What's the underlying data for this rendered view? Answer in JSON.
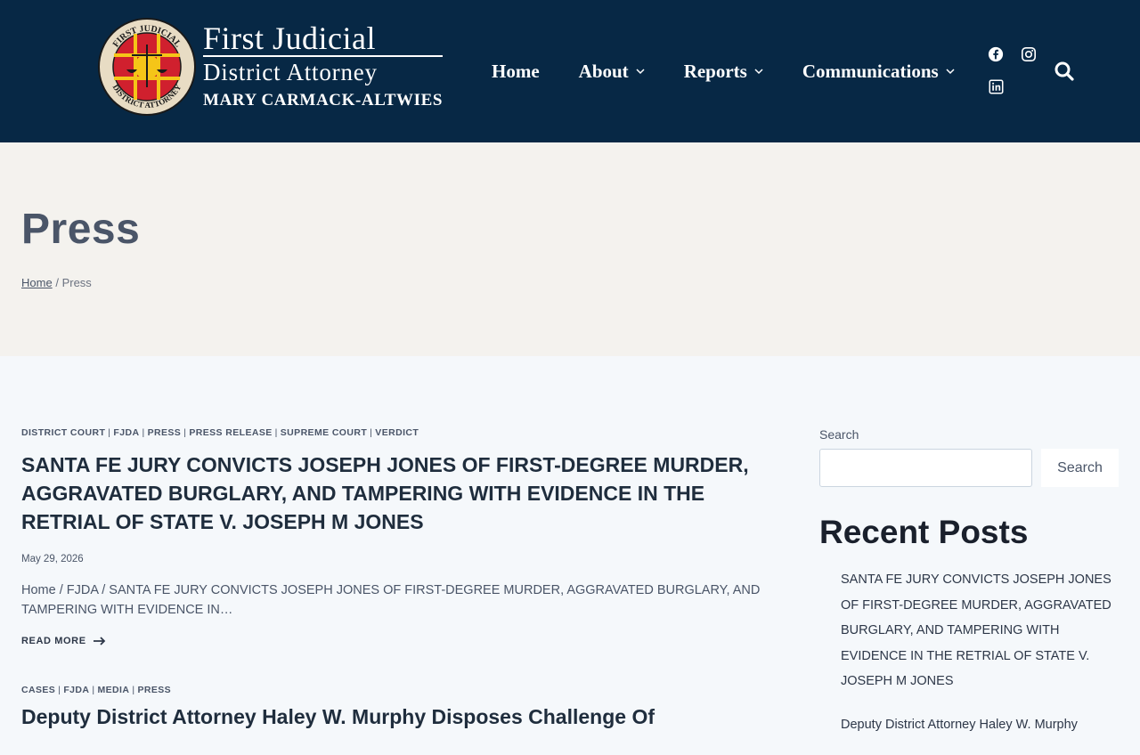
{
  "header": {
    "logo": {
      "seal_top_text": "FIRST JUDICIAL",
      "seal_bottom_text": "DISTRICT ATTORNEY",
      "line1": "First Judicial",
      "line2": "District Attorney",
      "line3": "MARY CARMACK-ALTWIES"
    },
    "nav": [
      {
        "label": "Home",
        "has_dropdown": false
      },
      {
        "label": "About",
        "has_dropdown": true
      },
      {
        "label": "Reports",
        "has_dropdown": true
      },
      {
        "label": "Communications",
        "has_dropdown": true
      }
    ],
    "social": [
      "facebook-icon",
      "instagram-icon",
      "linkedin-icon"
    ],
    "colors": {
      "bg": "#072845",
      "seal_red": "#d0202e",
      "seal_gold": "#f5c518"
    }
  },
  "hero": {
    "title": "Press",
    "breadcrumb": {
      "home": "Home",
      "separator": "/",
      "current": "Press"
    }
  },
  "posts": [
    {
      "categories": [
        "DISTRICT COURT",
        "FJDA",
        "PRESS",
        "PRESS RELEASE",
        "SUPREME COURT",
        "VERDICT"
      ],
      "title": "SANTA FE JURY CONVICTS JOSEPH JONES OF FIRST-DEGREE MURDER, AGGRAVATED BURGLARY, AND TAMPERING WITH EVIDENCE IN THE RETRIAL OF STATE V. JOSEPH M JONES",
      "date": "May 29, 2026",
      "excerpt": "Home / FJDA / SANTA FE JURY CONVICTS JOSEPH JONES OF FIRST-DEGREE MURDER, AGGRAVATED BURGLARY, AND TAMPERING WITH EVIDENCE IN…",
      "read_more": "READ MORE"
    },
    {
      "categories": [
        "CASES",
        "FJDA",
        "MEDIA",
        "PRESS"
      ],
      "title": "Deputy District Attorney Haley W. Murphy Disposes Challenge Of"
    }
  ],
  "sidebar": {
    "search_label": "Search",
    "search_placeholder": "",
    "search_button": "Search",
    "recent_title": "Recent Posts",
    "recent_posts": [
      "SANTA FE JURY CONVICTS JOSEPH JONES OF FIRST-DEGREE MURDER, AGGRAVATED BURGLARY, AND TAMPERING WITH EVIDENCE IN THE RETRIAL OF STATE V. JOSEPH M JONES",
      "Deputy District Attorney Haley W. Murphy"
    ]
  }
}
